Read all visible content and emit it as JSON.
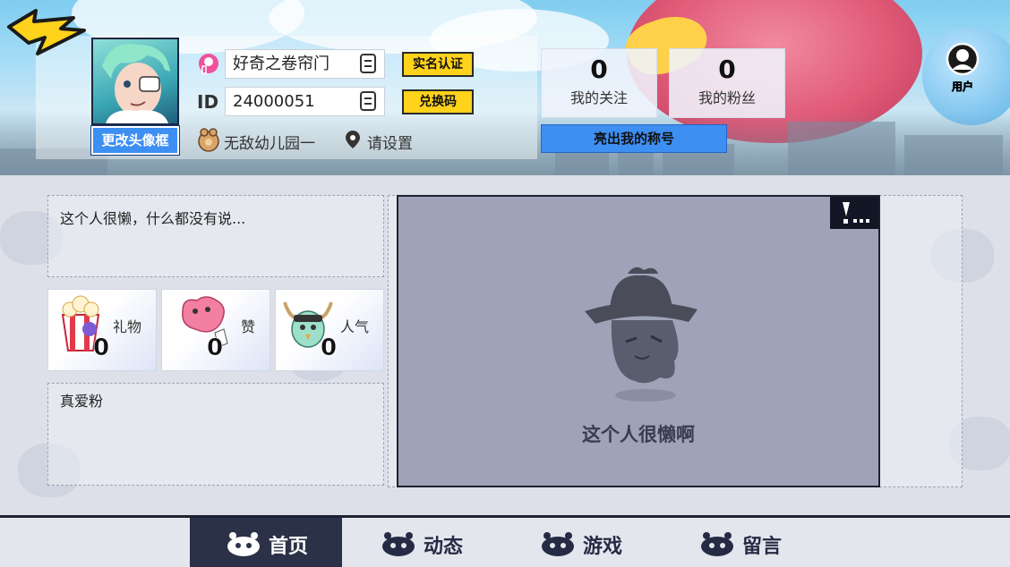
{
  "profile": {
    "nickname": "好奇之卷帘门",
    "id_label": "ID",
    "id_value": "24000051",
    "realname_button": "实名认证",
    "redeem_button": "兑换码",
    "change_frame_button": "更改头像框",
    "rank_label": "无敌幼儿园一",
    "location_label": "请设置"
  },
  "stats": {
    "following_count": "0",
    "following_label": "我的关注",
    "followers_count": "0",
    "followers_label": "我的粉丝",
    "title_button": "亮出我的称号"
  },
  "user_button_label": "用户",
  "bio_text": "这个人很懒，什么都没有说...",
  "cards": [
    {
      "label": "礼物",
      "count": "0",
      "icon": "popcorn-icon"
    },
    {
      "label": "赞",
      "count": "0",
      "icon": "heart-creature-icon"
    },
    {
      "label": "人气",
      "count": "0",
      "icon": "bird-icon"
    }
  ],
  "fans_label": "真爱粉",
  "showcase_empty_text": "这个人很懒啊",
  "nav": {
    "items": [
      {
        "label": "首页",
        "active": true
      },
      {
        "label": "动态",
        "active": false
      },
      {
        "label": "游戏",
        "active": false
      },
      {
        "label": "留言",
        "active": false
      }
    ]
  },
  "colors": {
    "accent_blue": "#3d8ff2",
    "accent_yellow": "#ffd21c",
    "nav_active": "#2b3147",
    "showcase_bg": "#9ea3b8"
  }
}
